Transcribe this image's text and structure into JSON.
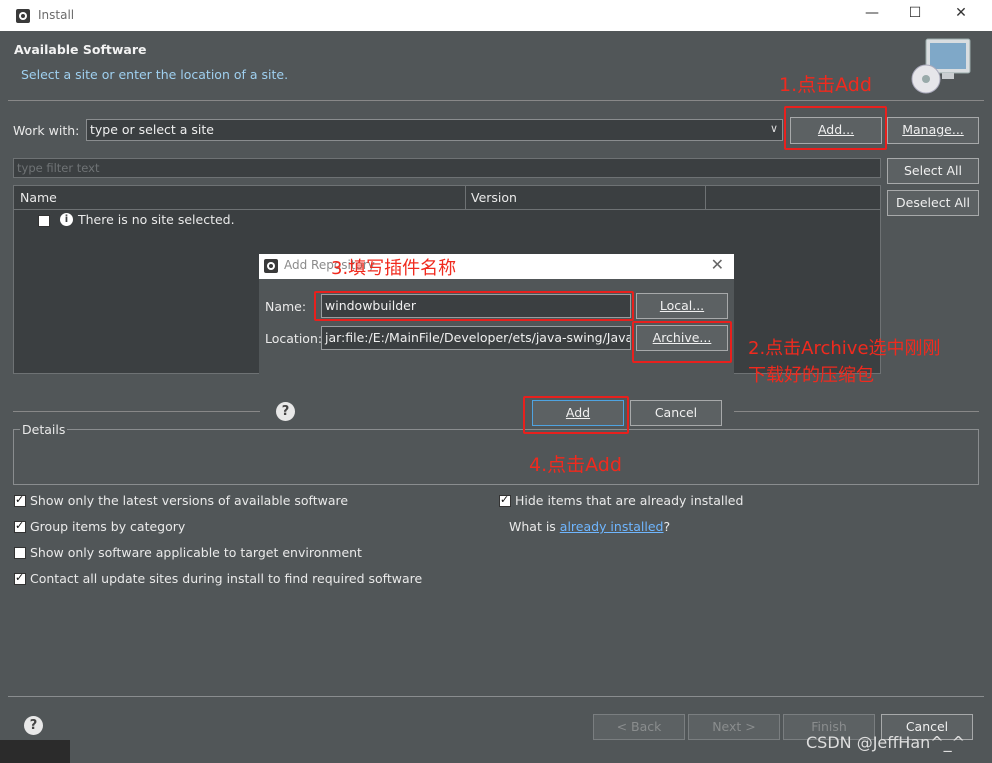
{
  "window": {
    "title": "Install",
    "minimize": "—",
    "maximize": "☐",
    "close": "✕"
  },
  "header": {
    "title": "Available Software",
    "subtitle": "Select a site or enter the location of a site."
  },
  "work_with": {
    "label": "Work with:",
    "placeholder": "type or select a site",
    "add_button": "Add...",
    "manage_button": "Manage..."
  },
  "filter": {
    "placeholder": "type filter text"
  },
  "side_buttons": {
    "select_all": "Select All",
    "deselect_all": "Deselect All"
  },
  "table": {
    "columns": [
      "Name",
      "Version"
    ],
    "empty_message": "There is no site selected."
  },
  "details": {
    "title": "Details"
  },
  "options": {
    "latest_versions": "Show only the latest versions of available software",
    "group_items": "Group items by category",
    "applicable_only": "Show only software applicable to target environment",
    "contact_sites": "Contact all update sites during install to find required software",
    "hide_installed": "Hide items that are already installed",
    "what_is_prefix": "What is ",
    "what_is_link": "already installed",
    "what_is_suffix": "?"
  },
  "footer": {
    "back": "< Back",
    "next": "Next >",
    "finish": "Finish",
    "cancel": "Cancel"
  },
  "dialog": {
    "title": "Add Repository",
    "name_label": "Name:",
    "name_value": "windowbuilder",
    "location_label": "Location:",
    "location_value": "jar:file:/E:/MainFile/Developer/ets/java-swing/Java-G",
    "local_button": "Local...",
    "archive_button": "Archive...",
    "add_button": "Add",
    "cancel_button": "Cancel"
  },
  "annotations": {
    "step1": "1.点击Add",
    "step2_line1": "2.点击Archive选中刚刚",
    "step2_line2": "下载好的压缩包",
    "step3": "3.填写插件名称",
    "step4": "4.点击Add"
  },
  "watermark": "CSDN @JeffHan^_^",
  "colors": {
    "annotation": "#e8201d",
    "link": "#6fb6ff",
    "background": "#515658"
  }
}
